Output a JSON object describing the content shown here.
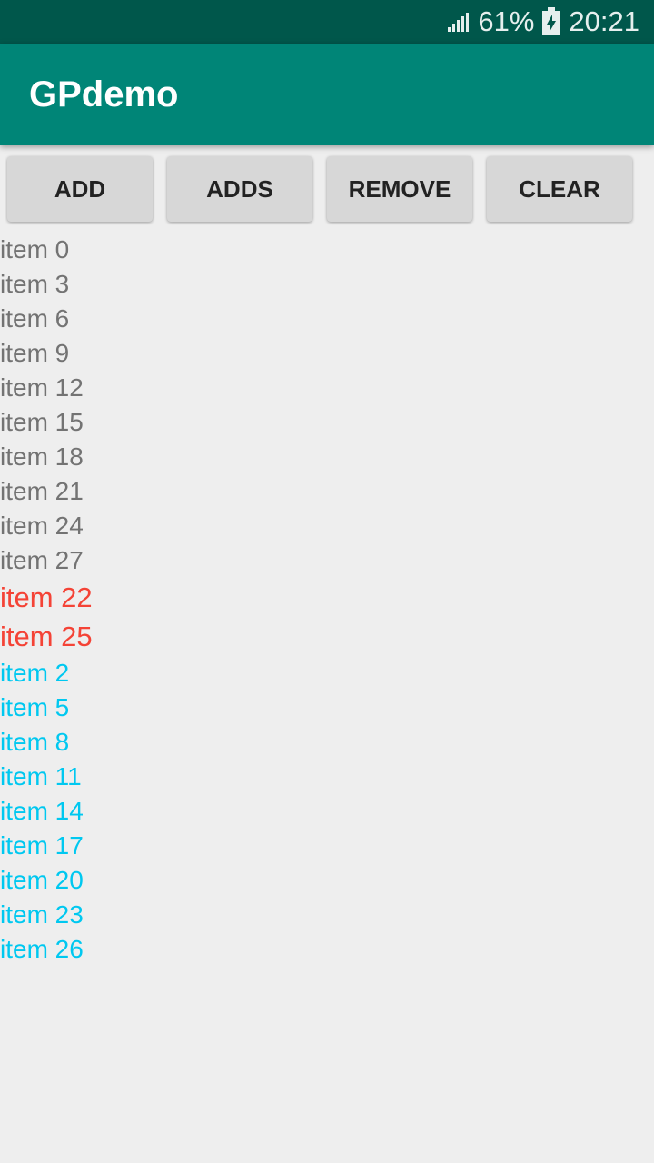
{
  "status_bar": {
    "battery": "61%",
    "time": "20:21",
    "icons": [
      "signal-icon",
      "battery-charging-icon"
    ]
  },
  "app_bar": {
    "title": "GPdemo",
    "background": "#008577"
  },
  "buttons": [
    {
      "label": "ADD"
    },
    {
      "label": "ADDS"
    },
    {
      "label": "REMOVE"
    },
    {
      "label": "CLEAR"
    }
  ],
  "list": {
    "items": [
      {
        "text": "item 0",
        "color": "#737373"
      },
      {
        "text": "item 3",
        "color": "#737373"
      },
      {
        "text": "item 6",
        "color": "#737373"
      },
      {
        "text": "item 9",
        "color": "#737373"
      },
      {
        "text": "item 12",
        "color": "#737373"
      },
      {
        "text": "item 15",
        "color": "#737373"
      },
      {
        "text": "item 18",
        "color": "#737373"
      },
      {
        "text": "item 21",
        "color": "#737373"
      },
      {
        "text": "item 24",
        "color": "#737373"
      },
      {
        "text": "item 27",
        "color": "#737373"
      },
      {
        "text": "item 22",
        "color": "#f44336"
      },
      {
        "text": "item 25",
        "color": "#f44336"
      },
      {
        "text": "item 2",
        "color": "#00c8f0"
      },
      {
        "text": "item 5",
        "color": "#00c8f0"
      },
      {
        "text": "item 8",
        "color": "#00c8f0"
      },
      {
        "text": "item 11",
        "color": "#00c8f0"
      },
      {
        "text": "item 14",
        "color": "#00c8f0"
      },
      {
        "text": "item 17",
        "color": "#00c8f0"
      },
      {
        "text": "item 20",
        "color": "#00c8f0"
      },
      {
        "text": "item 23",
        "color": "#00c8f0"
      },
      {
        "text": "item 26",
        "color": "#00c8f0"
      }
    ]
  }
}
